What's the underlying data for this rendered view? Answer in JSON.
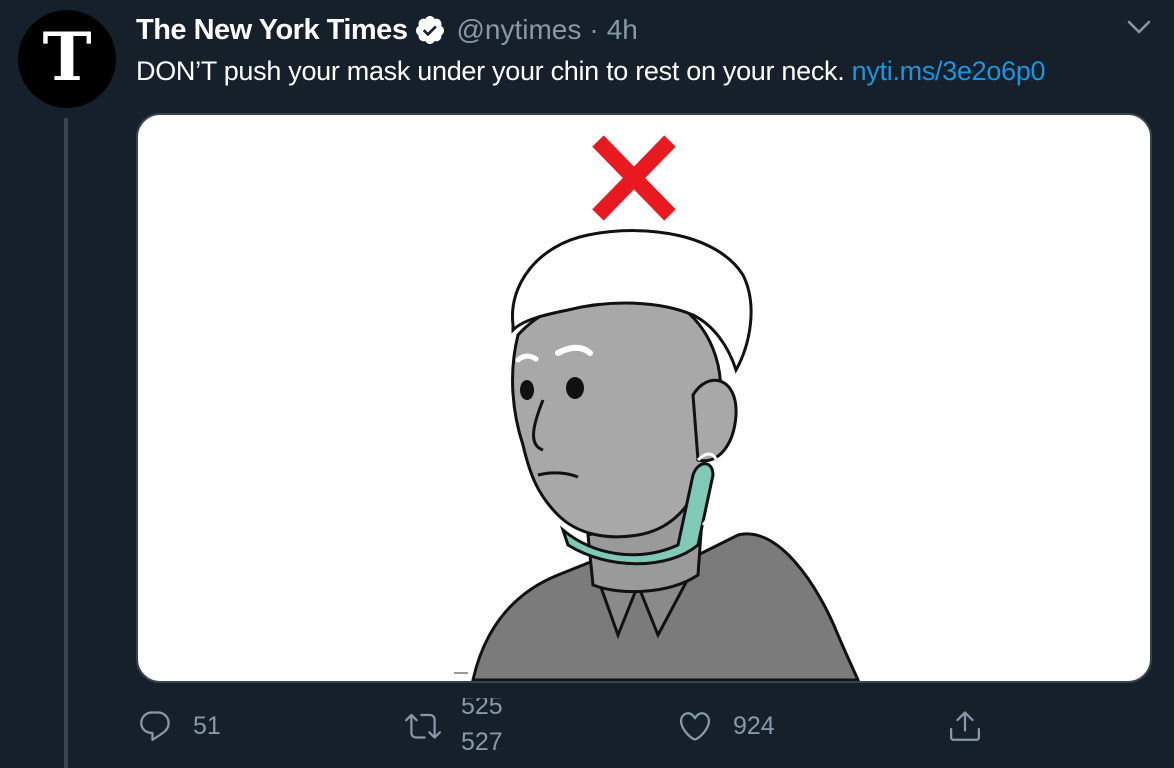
{
  "author": {
    "avatar_letter": "T",
    "display_name": "The New York Times",
    "handle": "@nytimes",
    "separator": "·",
    "time": "4h"
  },
  "tweet": {
    "text": "DON’T push your mask under your chin to rest on your neck. ",
    "link": "nyti.ms/3e2o6p0"
  },
  "actions": {
    "reply_count": "51",
    "retweet_count_old": "525",
    "retweet_count_new": "527",
    "like_count": "924"
  },
  "colors": {
    "background": "#15202b",
    "secondary_text": "#8899a6",
    "link": "#1b95e0",
    "divider": "#38444d",
    "mark_red": "#e8191f"
  },
  "icons": {
    "verified": "verified-badge-icon",
    "caret": "chevron-down-icon",
    "reply": "reply-icon",
    "retweet": "retweet-icon",
    "like": "heart-icon",
    "share": "share-icon"
  }
}
